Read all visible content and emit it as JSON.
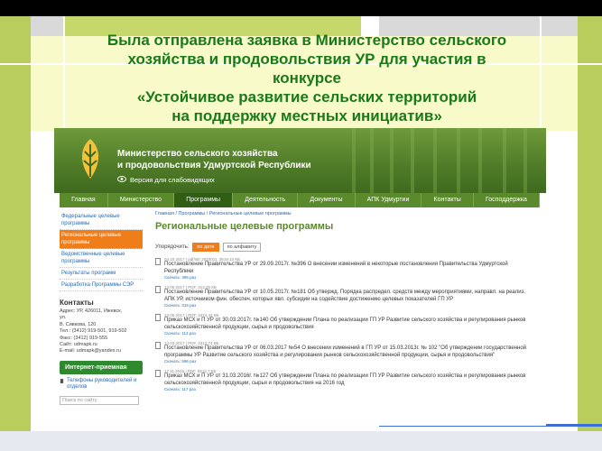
{
  "slide": {
    "title": "Была отправлена заявка в Министерство сельского\nхозяйства и продовольствия УР для участия в\nконкурсе\n«Устойчивое развитие сельских территорий\nна поддержку местных инициатив»"
  },
  "site": {
    "ministry_name_line1": "Министерство сельского хозяйства",
    "ministry_name_line2": "и продовольствия Удмуртской Республики",
    "low_vision_link": "Версия для слабовидящих",
    "nav": [
      "Главная",
      "Министерство",
      "Программы",
      "Деятельность",
      "Документы",
      "АПК Удмуртии",
      "Контакты",
      "Господдержка"
    ],
    "nav_active_index": 2,
    "sidebar": {
      "items": [
        "Федеральные целевые программы",
        "Региональные целевые программы",
        "Ведомственные целевые программы",
        "Результаты программ",
        "Разработка Программы СЭР"
      ],
      "active_index": 1,
      "contacts_heading": "Контакты",
      "contacts_text": "Адрес: УР, 426011, Ижевск,\nул.\nВ. Сивкова, 120\nТел.: (3412) 919-501, 919-502\nФакс: (3412) 919-555\nСайт: udmapk.ru\nE-mail: udmapk@yandex.ru",
      "reception_button": "Интернет-приемная",
      "phones_link": "Телефоны руководителей и отделов",
      "search_placeholder": "Поиск по сайту"
    },
    "breadcrumbs": "Главная / Программы / Региональные целевые программы",
    "page_heading": "Региональные целевые программы",
    "sort_label": "Упорядочить:",
    "sort_by_date": "по дате",
    "sort_by_alpha": "по алфавиту",
    "documents": [
      {
        "meta": "04.10.2017  |  pdf/sttr 2010011, 3619.10 КБ",
        "title": "Постановление Правительства УР от 29.09.2017г. №396 О внесении изменений в некоторые постановления Правительства Удмуртской Республики",
        "dl": "Скачать: 396 раз"
      },
      {
        "meta": "13.06.2017  |  PDF, 313.25 КБ",
        "title": "Постановление Правительства УР от 10.05.2017г. №181 Об утвержд. Порядка распредел. средств между мероприятиями, направл. на реализ. АПК УР, источником фин. обеспеч. которых явл. субсидии на содействие достижению целевых показателей ГП УР",
        "dl": "Скачать: 315 раз"
      },
      {
        "meta": "13.06.2017  |  PDF, 3474.44 КБ",
        "title": "Приказ МСХ и П УР от 30.03.2017г. №140 Об утверждении Плана по реализации ГП УР Развитие сельского хозяйства и регулирования рынков сельскохозяйственной продукции, сырья и продовольствия",
        "dl": "Скачать: 113 раз"
      },
      {
        "meta": "14.03.2017  |  PDF, 4312.74 КБ",
        "title": "Постановление Правительства УР от 06.03.2017 №54 О внесении изменений в ГП УР от 15.03.2013г. № 102 \"Об утверждении государственной программы УР Развитие сельского хозяйства и регулирования рынков сельскохозяйственной продукции, сырья и продовольствия\"",
        "dl": "Скачать: 596 раз"
      },
      {
        "meta": "17.11.2016  |  PDF, 6512.7 КБ",
        "title": "Приказ МСХ и П УР от 31.03.2016г. №127 Об утверждении Плана по реализации ГП УР Развитие сельского хозяйства и регулирования рынков сельскохозяйственной продукции, сырья и продовольствия на 2016 год",
        "dl": "Скачать: 117 раз"
      }
    ]
  },
  "colors": {
    "title_green": "#1a7a1a",
    "accent_orange": "#ef7d1a",
    "header_green": "#4f7b28"
  }
}
